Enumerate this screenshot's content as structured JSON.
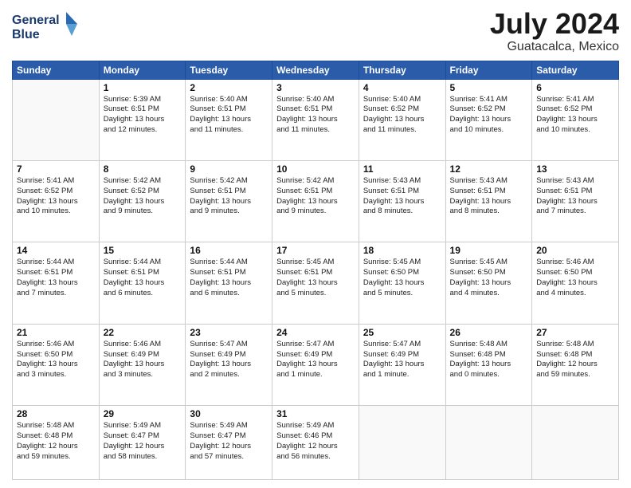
{
  "logo": {
    "line1": "General",
    "line2": "Blue"
  },
  "title": "July 2024",
  "location": "Guatacalca, Mexico",
  "days_of_week": [
    "Sunday",
    "Monday",
    "Tuesday",
    "Wednesday",
    "Thursday",
    "Friday",
    "Saturday"
  ],
  "weeks": [
    [
      {
        "day": "",
        "info": ""
      },
      {
        "day": "1",
        "info": "Sunrise: 5:39 AM\nSunset: 6:51 PM\nDaylight: 13 hours\nand 12 minutes."
      },
      {
        "day": "2",
        "info": "Sunrise: 5:40 AM\nSunset: 6:51 PM\nDaylight: 13 hours\nand 11 minutes."
      },
      {
        "day": "3",
        "info": "Sunrise: 5:40 AM\nSunset: 6:51 PM\nDaylight: 13 hours\nand 11 minutes."
      },
      {
        "day": "4",
        "info": "Sunrise: 5:40 AM\nSunset: 6:52 PM\nDaylight: 13 hours\nand 11 minutes."
      },
      {
        "day": "5",
        "info": "Sunrise: 5:41 AM\nSunset: 6:52 PM\nDaylight: 13 hours\nand 10 minutes."
      },
      {
        "day": "6",
        "info": "Sunrise: 5:41 AM\nSunset: 6:52 PM\nDaylight: 13 hours\nand 10 minutes."
      }
    ],
    [
      {
        "day": "7",
        "info": "Sunrise: 5:41 AM\nSunset: 6:52 PM\nDaylight: 13 hours\nand 10 minutes."
      },
      {
        "day": "8",
        "info": "Sunrise: 5:42 AM\nSunset: 6:52 PM\nDaylight: 13 hours\nand 9 minutes."
      },
      {
        "day": "9",
        "info": "Sunrise: 5:42 AM\nSunset: 6:51 PM\nDaylight: 13 hours\nand 9 minutes."
      },
      {
        "day": "10",
        "info": "Sunrise: 5:42 AM\nSunset: 6:51 PM\nDaylight: 13 hours\nand 9 minutes."
      },
      {
        "day": "11",
        "info": "Sunrise: 5:43 AM\nSunset: 6:51 PM\nDaylight: 13 hours\nand 8 minutes."
      },
      {
        "day": "12",
        "info": "Sunrise: 5:43 AM\nSunset: 6:51 PM\nDaylight: 13 hours\nand 8 minutes."
      },
      {
        "day": "13",
        "info": "Sunrise: 5:43 AM\nSunset: 6:51 PM\nDaylight: 13 hours\nand 7 minutes."
      }
    ],
    [
      {
        "day": "14",
        "info": "Sunrise: 5:44 AM\nSunset: 6:51 PM\nDaylight: 13 hours\nand 7 minutes."
      },
      {
        "day": "15",
        "info": "Sunrise: 5:44 AM\nSunset: 6:51 PM\nDaylight: 13 hours\nand 6 minutes."
      },
      {
        "day": "16",
        "info": "Sunrise: 5:44 AM\nSunset: 6:51 PM\nDaylight: 13 hours\nand 6 minutes."
      },
      {
        "day": "17",
        "info": "Sunrise: 5:45 AM\nSunset: 6:51 PM\nDaylight: 13 hours\nand 5 minutes."
      },
      {
        "day": "18",
        "info": "Sunrise: 5:45 AM\nSunset: 6:50 PM\nDaylight: 13 hours\nand 5 minutes."
      },
      {
        "day": "19",
        "info": "Sunrise: 5:45 AM\nSunset: 6:50 PM\nDaylight: 13 hours\nand 4 minutes."
      },
      {
        "day": "20",
        "info": "Sunrise: 5:46 AM\nSunset: 6:50 PM\nDaylight: 13 hours\nand 4 minutes."
      }
    ],
    [
      {
        "day": "21",
        "info": "Sunrise: 5:46 AM\nSunset: 6:50 PM\nDaylight: 13 hours\nand 3 minutes."
      },
      {
        "day": "22",
        "info": "Sunrise: 5:46 AM\nSunset: 6:49 PM\nDaylight: 13 hours\nand 3 minutes."
      },
      {
        "day": "23",
        "info": "Sunrise: 5:47 AM\nSunset: 6:49 PM\nDaylight: 13 hours\nand 2 minutes."
      },
      {
        "day": "24",
        "info": "Sunrise: 5:47 AM\nSunset: 6:49 PM\nDaylight: 13 hours\nand 1 minute."
      },
      {
        "day": "25",
        "info": "Sunrise: 5:47 AM\nSunset: 6:49 PM\nDaylight: 13 hours\nand 1 minute."
      },
      {
        "day": "26",
        "info": "Sunrise: 5:48 AM\nSunset: 6:48 PM\nDaylight: 13 hours\nand 0 minutes."
      },
      {
        "day": "27",
        "info": "Sunrise: 5:48 AM\nSunset: 6:48 PM\nDaylight: 12 hours\nand 59 minutes."
      }
    ],
    [
      {
        "day": "28",
        "info": "Sunrise: 5:48 AM\nSunset: 6:48 PM\nDaylight: 12 hours\nand 59 minutes."
      },
      {
        "day": "29",
        "info": "Sunrise: 5:49 AM\nSunset: 6:47 PM\nDaylight: 12 hours\nand 58 minutes."
      },
      {
        "day": "30",
        "info": "Sunrise: 5:49 AM\nSunset: 6:47 PM\nDaylight: 12 hours\nand 57 minutes."
      },
      {
        "day": "31",
        "info": "Sunrise: 5:49 AM\nSunset: 6:46 PM\nDaylight: 12 hours\nand 56 minutes."
      },
      {
        "day": "",
        "info": ""
      },
      {
        "day": "",
        "info": ""
      },
      {
        "day": "",
        "info": ""
      }
    ]
  ]
}
